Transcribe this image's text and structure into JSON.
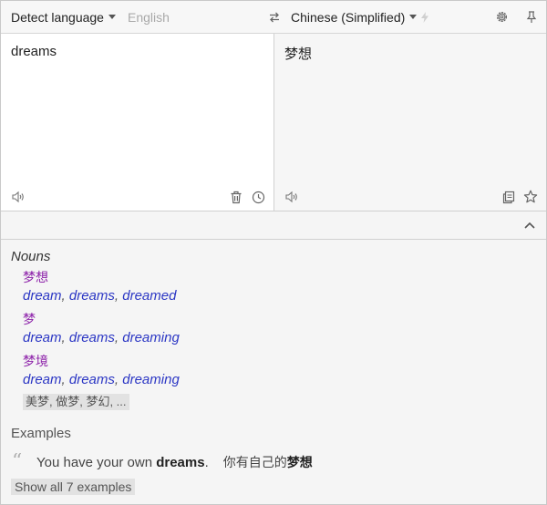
{
  "toolbar": {
    "source_language": "Detect language",
    "detected_language": "English",
    "target_language": "Chinese (Simplified)"
  },
  "source": {
    "text": "dreams"
  },
  "target": {
    "text": "梦想"
  },
  "dictionary": {
    "part_of_speech": "Nouns",
    "entries": [
      {
        "word": "梦想",
        "back": [
          "dream",
          "dreams",
          "dreamed"
        ]
      },
      {
        "word": "梦",
        "back": [
          "dream",
          "dreams",
          "dreaming"
        ]
      },
      {
        "word": "梦境",
        "back": [
          "dream",
          "dreams",
          "dreaming"
        ]
      }
    ],
    "more": "美梦, 做梦, 梦幻, ...",
    "separator": ","
  },
  "examples": {
    "title": "Examples",
    "items": [
      {
        "src_before": "You have your own ",
        "src_bold": "dreams",
        "src_after": ".",
        "dst_before": "你有自己的",
        "dst_bold": "梦想"
      }
    ],
    "show_all": "Show all 7 examples"
  },
  "icons": {
    "swap": "swap-icon",
    "settings": "gear-icon",
    "pin": "pin-icon",
    "instant": "lightning-icon",
    "speak": "speaker-icon",
    "clear": "trash-icon",
    "history": "clock-icon",
    "copy": "copy-icon",
    "favorite": "star-icon",
    "collapse": "chevron-up-icon",
    "quote": "quote-icon"
  },
  "colors": {
    "translation_word": "#8e24aa",
    "back_translation": "#2b36c4"
  }
}
